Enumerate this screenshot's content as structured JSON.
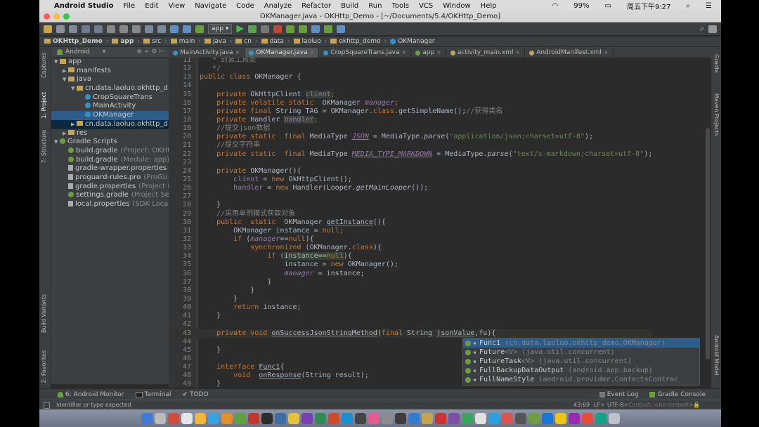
{
  "mac_menu": {
    "app_name": "Android Studio",
    "items": [
      "File",
      "Edit",
      "View",
      "Navigate",
      "Code",
      "Analyze",
      "Refactor",
      "Build",
      "Run",
      "Tools",
      "VCS",
      "Window",
      "Help"
    ],
    "battery": "99%",
    "clock": "周五下午9:27"
  },
  "window_title": "OKManager.java - OKHttp_Demo - [~/Documents/5.4/OKHttp_Demo]",
  "toolbar": {
    "run_config": "app"
  },
  "breadcrumbs": [
    "OKHttp_Demo",
    "app",
    "src",
    "main",
    "java",
    "cn",
    "data",
    "laoluo",
    "okhttp_demo",
    "OKManager"
  ],
  "left_tool_tabs": [
    "1: Project",
    "Captures",
    "7: Structure",
    "Build Variants",
    "2: Favorites"
  ],
  "right_tool_tabs": [
    "Gradle",
    "Maven Projects",
    "Android Model"
  ],
  "project_panel": {
    "view_mode": "Android",
    "tree": [
      {
        "label": "app",
        "hint": "",
        "indent": 0,
        "kind": "folder",
        "arrow": "▼"
      },
      {
        "label": "manifests",
        "hint": "",
        "indent": 1,
        "kind": "folder",
        "arrow": "▶"
      },
      {
        "label": "java",
        "hint": "",
        "indent": 1,
        "kind": "folder",
        "arrow": "▼"
      },
      {
        "label": "cn.data.laoluo.okhttp_d",
        "hint": "",
        "indent": 2,
        "kind": "folder",
        "arrow": "▼"
      },
      {
        "label": "CropSquareTrans",
        "hint": "",
        "indent": 3,
        "kind": "class",
        "arrow": ""
      },
      {
        "label": "MainActivity",
        "hint": "",
        "indent": 3,
        "kind": "class",
        "arrow": ""
      },
      {
        "label": "OKManager",
        "hint": "",
        "indent": 3,
        "kind": "class",
        "arrow": "",
        "selected": true
      },
      {
        "label": "cn.data.laoluo.okhttp_d",
        "hint": "",
        "indent": 2,
        "kind": "folder",
        "arrow": "▶",
        "highlight": true
      },
      {
        "label": "res",
        "hint": "",
        "indent": 1,
        "kind": "folder",
        "arrow": "▶"
      },
      {
        "label": "Gradle Scripts",
        "hint": "",
        "indent": 0,
        "kind": "gradle",
        "arrow": "▼"
      },
      {
        "label": "build.gradle",
        "hint": "(Project: OKHt",
        "indent": 1,
        "kind": "gradle",
        "arrow": ""
      },
      {
        "label": "build.gradle",
        "hint": "(Module: app)",
        "indent": 1,
        "kind": "gradle",
        "arrow": ""
      },
      {
        "label": "gradle-wrapper.properties",
        "hint": "",
        "indent": 1,
        "kind": "file",
        "arrow": ""
      },
      {
        "label": "proguard-rules.pro",
        "hint": "(ProGu",
        "indent": 1,
        "kind": "file",
        "arrow": ""
      },
      {
        "label": "gradle.properties",
        "hint": "(Project P",
        "indent": 1,
        "kind": "file",
        "arrow": ""
      },
      {
        "label": "settings.gradle",
        "hint": "(Project Set",
        "indent": 1,
        "kind": "gradle",
        "arrow": ""
      },
      {
        "label": "local.properties",
        "hint": "(SDK Locat",
        "indent": 1,
        "kind": "file",
        "arrow": ""
      }
    ]
  },
  "editor_tabs": [
    {
      "label": "MainActivity.java",
      "color": "#3592c4",
      "active": false
    },
    {
      "label": "OKManager.java",
      "color": "#3592c4",
      "active": true
    },
    {
      "label": "CropSquareTrans.java",
      "color": "#3592c4",
      "active": false
    },
    {
      "label": "app",
      "color": "#6a9e3e",
      "active": false
    },
    {
      "label": "activity_main.xml",
      "color": "#c7a450",
      "active": false
    },
    {
      "label": "AndroidManifest.xml",
      "color": "#c7a450",
      "active": false
    }
  ],
  "code_lines": [
    {
      "n": "11",
      "cur": false,
      "segs": [
        {
          "c": "cm",
          "t": "   * 封装工具类"
        }
      ]
    },
    {
      "n": "12",
      "cur": false,
      "segs": [
        {
          "c": "cm",
          "t": "   */"
        }
      ]
    },
    {
      "n": "13",
      "cur": false,
      "segs": [
        {
          "c": "k",
          "t": "public class "
        },
        {
          "c": "t",
          "t": "OKManager {"
        }
      ]
    },
    {
      "n": "14",
      "cur": false,
      "segs": []
    },
    {
      "n": "15",
      "cur": false,
      "segs": [
        {
          "c": "k",
          "t": "    private "
        },
        {
          "c": "t",
          "t": "OkHttpClient "
        },
        {
          "c": "fld hl",
          "t": "client"
        },
        {
          "c": "k",
          "t": ";"
        }
      ]
    },
    {
      "n": "16",
      "cur": false,
      "segs": [
        {
          "c": "k",
          "t": "    private volatile static  "
        },
        {
          "c": "t",
          "t": "OKManager "
        },
        {
          "c": "fi",
          "t": "manager"
        },
        {
          "c": "k",
          "t": ";"
        }
      ]
    },
    {
      "n": "17",
      "cur": false,
      "segs": [
        {
          "c": "k",
          "t": "    private final "
        },
        {
          "c": "t",
          "t": "String TAG = OKManager."
        },
        {
          "c": "k",
          "t": "class"
        },
        {
          "c": "t",
          "t": ".getSimpleName();"
        },
        {
          "c": "cm",
          "t": "//获得类名"
        }
      ]
    },
    {
      "n": "18",
      "cur": false,
      "segs": [
        {
          "c": "k",
          "t": "    private "
        },
        {
          "c": "t",
          "t": "Handler "
        },
        {
          "c": "fld hl",
          "t": "handler"
        },
        {
          "c": "k",
          "t": ";"
        }
      ]
    },
    {
      "n": "19",
      "cur": false,
      "segs": [
        {
          "c": "cm",
          "t": "    //提交json数据"
        }
      ]
    },
    {
      "n": "20",
      "cur": false,
      "segs": [
        {
          "c": "k",
          "t": "    private static  final "
        },
        {
          "c": "t",
          "t": "MediaType "
        },
        {
          "c": "fi ul",
          "t": "JSON"
        },
        {
          "c": "t",
          "t": " = MediaType."
        },
        {
          "c": "mi t",
          "t": "parse"
        },
        {
          "c": "t",
          "t": "("
        },
        {
          "c": "st",
          "t": "\"application/json;charset=utf-8\""
        },
        {
          "c": "t",
          "t": ");"
        }
      ]
    },
    {
      "n": "21",
      "cur": false,
      "segs": [
        {
          "c": "cm",
          "t": "    //提交字符串"
        }
      ]
    },
    {
      "n": "22",
      "cur": false,
      "segs": [
        {
          "c": "k",
          "t": "    private static  final "
        },
        {
          "c": "t",
          "t": "MediaType "
        },
        {
          "c": "fi ul",
          "t": "MEDIA_TYPE_MARKDOWN"
        },
        {
          "c": "t",
          "t": " = MediaType."
        },
        {
          "c": "mi t",
          "t": "parse"
        },
        {
          "c": "t",
          "t": "("
        },
        {
          "c": "st",
          "t": "\"text/x-markdown;charset=utf-8\""
        },
        {
          "c": "t",
          "t": ");"
        }
      ]
    },
    {
      "n": "23",
      "cur": false,
      "segs": []
    },
    {
      "n": "24",
      "cur": false,
      "segs": [
        {
          "c": "k",
          "t": "    private "
        },
        {
          "c": "t",
          "t": "OKManager(){"
        }
      ]
    },
    {
      "n": "25",
      "cur": false,
      "segs": [
        {
          "c": "fld",
          "t": "        client"
        },
        {
          "c": "t",
          "t": " = "
        },
        {
          "c": "k",
          "t": "new "
        },
        {
          "c": "t",
          "t": "OkHttpClient();"
        }
      ]
    },
    {
      "n": "26",
      "cur": false,
      "segs": [
        {
          "c": "fld",
          "t": "        handler"
        },
        {
          "c": "t",
          "t": " = "
        },
        {
          "c": "k",
          "t": "new "
        },
        {
          "c": "t",
          "t": "Handler(Looper."
        },
        {
          "c": "mi t",
          "t": "getMainLooper"
        },
        {
          "c": "t",
          "t": "());"
        }
      ]
    },
    {
      "n": "27",
      "cur": false,
      "segs": []
    },
    {
      "n": "28",
      "cur": false,
      "segs": [
        {
          "c": "t",
          "t": "    }"
        }
      ]
    },
    {
      "n": "29",
      "cur": false,
      "segs": [
        {
          "c": "cm",
          "t": "    //采用单例模式获取对象"
        }
      ]
    },
    {
      "n": "30",
      "cur": false,
      "segs": [
        {
          "c": "k",
          "t": "    public  static  "
        },
        {
          "c": "t",
          "t": "OKManager "
        },
        {
          "c": "t ul",
          "t": "getInstance"
        },
        {
          "c": "t",
          "t": "(){"
        }
      ]
    },
    {
      "n": "31",
      "cur": false,
      "segs": [
        {
          "c": "t",
          "t": "        OKManager instance = "
        },
        {
          "c": "k",
          "t": "null;"
        }
      ]
    },
    {
      "n": "32",
      "cur": false,
      "segs": [
        {
          "c": "k",
          "t": "        if "
        },
        {
          "c": "t",
          "t": "("
        },
        {
          "c": "fi",
          "t": "manager"
        },
        {
          "c": "t",
          "t": "=="
        },
        {
          "c": "k",
          "t": "null"
        },
        {
          "c": "t",
          "t": "){"
        }
      ]
    },
    {
      "n": "33",
      "cur": false,
      "segs": [
        {
          "c": "k",
          "t": "            synchronized "
        },
        {
          "c": "t",
          "t": "(OKManager."
        },
        {
          "c": "k",
          "t": "class"
        },
        {
          "c": "t",
          "t": "){"
        }
      ]
    },
    {
      "n": "34",
      "cur": false,
      "segs": [
        {
          "c": "k",
          "t": "                if "
        },
        {
          "c": "t",
          "t": "("
        },
        {
          "c": "t hl",
          "t": "instance=="
        },
        {
          "c": "k hl",
          "t": "null"
        },
        {
          "c": "t",
          "t": "){"
        }
      ]
    },
    {
      "n": "35",
      "cur": false,
      "segs": [
        {
          "c": "t",
          "t": "                    instance = "
        },
        {
          "c": "k",
          "t": "new "
        },
        {
          "c": "t",
          "t": "OKManager();"
        }
      ]
    },
    {
      "n": "36",
      "cur": false,
      "segs": [
        {
          "c": "fi",
          "t": "                    manager"
        },
        {
          "c": "t",
          "t": " = instance;"
        }
      ]
    },
    {
      "n": "37",
      "cur": false,
      "segs": [
        {
          "c": "t",
          "t": "                }"
        }
      ]
    },
    {
      "n": "38",
      "cur": false,
      "segs": [
        {
          "c": "t",
          "t": "            }"
        }
      ]
    },
    {
      "n": "39",
      "cur": false,
      "segs": [
        {
          "c": "t",
          "t": "        }"
        }
      ]
    },
    {
      "n": "40",
      "cur": false,
      "segs": [
        {
          "c": "k",
          "t": "        return "
        },
        {
          "c": "t",
          "t": "instance;"
        }
      ]
    },
    {
      "n": "41",
      "cur": false,
      "segs": [
        {
          "c": "t",
          "t": "    }"
        }
      ]
    },
    {
      "n": "42",
      "cur": false,
      "segs": []
    },
    {
      "n": "43",
      "cur": true,
      "segs": [
        {
          "c": "k",
          "t": "    private void "
        },
        {
          "c": "t ul",
          "t": "onSuccessJsonStringMethod"
        },
        {
          "c": "t",
          "t": "("
        },
        {
          "c": "k",
          "t": "final "
        },
        {
          "c": "t",
          "t": "String "
        },
        {
          "c": "t ul",
          "t": "jsonValue"
        },
        {
          "c": "t",
          "t": ",fu){"
        }
      ]
    },
    {
      "n": "44",
      "cur": false,
      "segs": []
    },
    {
      "n": "45",
      "cur": false,
      "segs": [
        {
          "c": "t",
          "t": "    }"
        }
      ]
    },
    {
      "n": "46",
      "cur": false,
      "segs": []
    },
    {
      "n": "47",
      "cur": false,
      "segs": [
        {
          "c": "k",
          "t": "    interface "
        },
        {
          "c": "t ul",
          "t": "Func1"
        },
        {
          "c": "t",
          "t": "{"
        }
      ]
    },
    {
      "n": "48",
      "cur": false,
      "segs": [
        {
          "c": "k",
          "t": "        void  "
        },
        {
          "c": "t ul",
          "t": "onResponse"
        },
        {
          "c": "t",
          "t": "(String result);"
        }
      ]
    },
    {
      "n": "49",
      "cur": false,
      "segs": [
        {
          "c": "t",
          "t": "    }"
        }
      ]
    }
  ],
  "completion": [
    {
      "name": "Func1",
      "generic": "",
      "detail": "(cn.data.laoluo.okhttp_demo.OKManager)",
      "selected": true
    },
    {
      "name": "Future",
      "generic": "<V>",
      "detail": "(java.util.concurrent)",
      "selected": false
    },
    {
      "name": "FutureTask",
      "generic": "<V>",
      "detail": "(java.util.concurrent)",
      "selected": false
    },
    {
      "name": "FullBackupDataOutput",
      "generic": "",
      "detail": "(android.app.backup)",
      "selected": false
    },
    {
      "name": "FullNameStyle",
      "generic": "",
      "detail": "(android.provider.ContactsContrac",
      "selected": false
    }
  ],
  "bottom_tools": {
    "android_monitor": "6: Android Monitor",
    "terminal": "Terminal",
    "todo": "TODO",
    "event_log": "Event Log",
    "gradle_console": "Gradle Console"
  },
  "status": {
    "message": "Identifier or type expected",
    "position": "43:69",
    "line_sep": "LF÷",
    "encoding": "UTF-8÷",
    "context": "Context: <no context>"
  }
}
